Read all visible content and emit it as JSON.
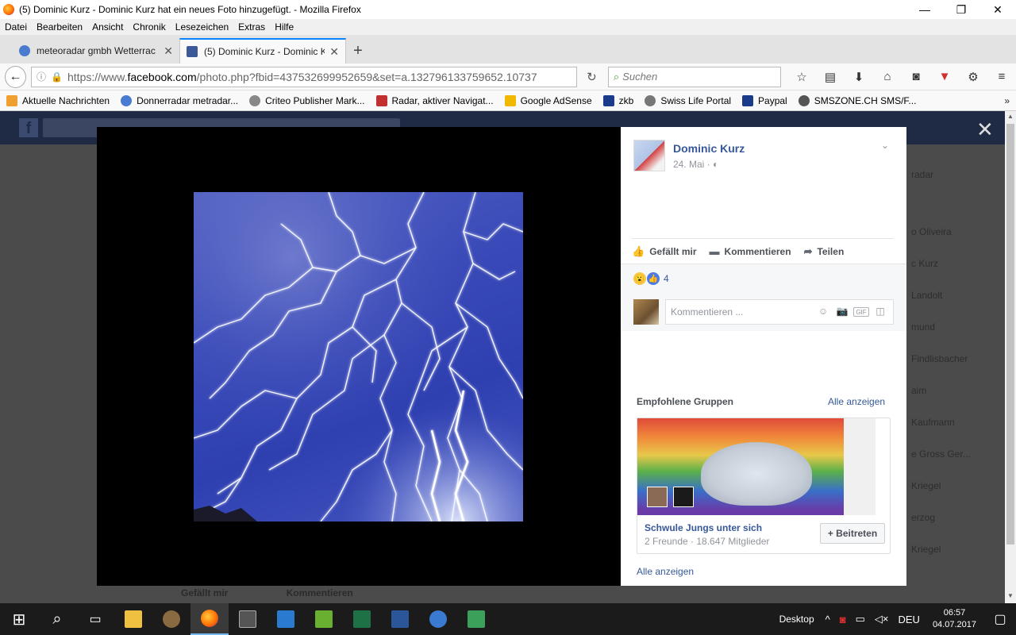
{
  "window": {
    "title": "(5) Dominic Kurz - Dominic Kurz hat ein neues Foto hinzugefügt. - Mozilla Firefox",
    "min": "—",
    "max": "❐",
    "close": "✕"
  },
  "menu": [
    "Datei",
    "Bearbeiten",
    "Ansicht",
    "Chronik",
    "Lesezeichen",
    "Extras",
    "Hilfe"
  ],
  "tabs": [
    {
      "label": "meteoradar gmbh Wetterrac",
      "close": "✕"
    },
    {
      "label": "(5) Dominic Kurz - Dominic K",
      "close": "✕"
    }
  ],
  "newtab": "+",
  "nav": {
    "back": "←",
    "info": "ⓘ",
    "lock": "🔒",
    "url_pre": "https://www.",
    "url_domain": "facebook.com",
    "url_rest": "/photo.php?fbid=437532699952659&set=a.132796133759652.10737",
    "reload": "↻",
    "search_placeholder": "Suchen"
  },
  "toolbar_icons": [
    "☆",
    "▤",
    "⬇",
    "⌂",
    "◙",
    "▼",
    "⚙",
    "≡"
  ],
  "bookmarks": [
    {
      "label": "Aktuelle Nachrichten",
      "color": "#f0a030"
    },
    {
      "label": "Donnerradar metradar...",
      "color": "#4a7bd0"
    },
    {
      "label": "Criteo Publisher Mark...",
      "color": "#888888"
    },
    {
      "label": "Radar, aktiver Navigat...",
      "color": "#c03030"
    },
    {
      "label": "Google AdSense",
      "color": "#f2b800"
    },
    {
      "label": "zkb",
      "color": "#1a3a8a"
    },
    {
      "label": "Swiss Life Portal",
      "color": "#777777"
    },
    {
      "label": "Paypal",
      "color": "#1a3a8a"
    },
    {
      "label": "SMSZONE.CH SMS/F...",
      "color": "#555555"
    }
  ],
  "bookmarks_more": "»",
  "fb_bg": {
    "logo": "f",
    "side": [
      "radar",
      "o Oliveira",
      "c Kurz",
      "Landolt",
      "mund",
      "Findlisbacher",
      "aim",
      "Kaufmann",
      "e Gross Ger...",
      "Kriegel",
      "erzog",
      "Kriegel"
    ],
    "bottom_like": "Gefällt mir",
    "bottom_comment": "Kommentieren"
  },
  "overlay_close": "✕",
  "post": {
    "author": "Dominic Kurz",
    "date": "24. Mai · ",
    "audience_icon": "◐",
    "chevron": "⌄",
    "actions": [
      {
        "label": "Gefällt mir",
        "icon": "👍"
      },
      {
        "label": "Kommentieren",
        "icon": "▬"
      },
      {
        "label": "Teilen",
        "icon": "➦"
      }
    ],
    "reaction_wow": "😮",
    "reaction_like": "👍",
    "reaction_count": "4",
    "comment_placeholder": "Kommentieren ...",
    "comment_icons": [
      "☺",
      "📷",
      "GIF",
      "◫"
    ]
  },
  "groups": {
    "title": "Empfohlene Gruppen",
    "all": "Alle anzeigen",
    "card": {
      "name": "Schwule Jungs unter sich",
      "meta": "2 Freunde · 18.647 Mitglieder",
      "join": "+ Beitreten"
    },
    "all_bottom": "Alle anzeigen"
  },
  "taskbar": {
    "start": "⊞",
    "search": "⌕",
    "taskview": "▭",
    "apps": [
      {
        "name": "explorer",
        "color": "#f0c040"
      },
      {
        "name": "app2",
        "color": "#8a6a40"
      },
      {
        "name": "firefox",
        "color": "#ff7a1a"
      },
      {
        "name": "app4",
        "color": "#555555"
      },
      {
        "name": "app5",
        "color": "#2a7ad0"
      },
      {
        "name": "app6",
        "color": "#6ab030"
      },
      {
        "name": "excel",
        "color": "#1e7145"
      },
      {
        "name": "word",
        "color": "#2b579a"
      },
      {
        "name": "app9",
        "color": "#3a7ad0"
      },
      {
        "name": "app10",
        "color": "#3aa05a"
      }
    ],
    "desktop": "Desktop",
    "lang": "DEU",
    "time": "06:57",
    "date": "04.07.2017"
  }
}
